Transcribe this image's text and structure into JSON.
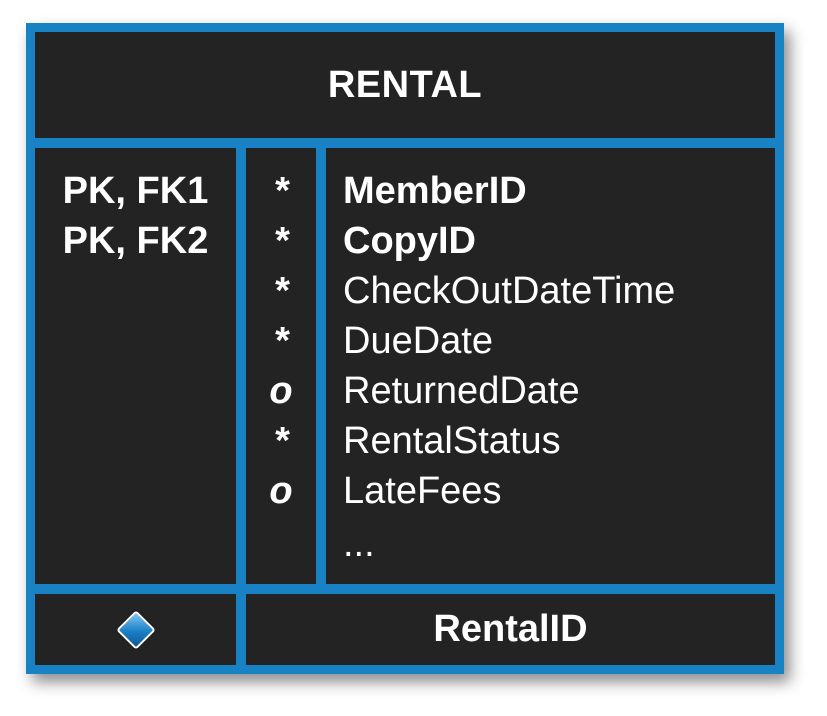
{
  "entity": {
    "name": "RENTAL",
    "key_labels": [
      "PK, FK1",
      "PK, FK2"
    ],
    "attributes": [
      {
        "optionality": "*",
        "name": "MemberID",
        "bold": true
      },
      {
        "optionality": "*",
        "name": "CopyID",
        "bold": true
      },
      {
        "optionality": "*",
        "name": "CheckOutDateTime",
        "bold": false
      },
      {
        "optionality": "*",
        "name": "DueDate",
        "bold": false
      },
      {
        "optionality": "o",
        "name": "ReturnedDate",
        "bold": false
      },
      {
        "optionality": "*",
        "name": "RentalStatus",
        "bold": false
      },
      {
        "optionality": "o",
        "name": "LateFees",
        "bold": false
      }
    ],
    "more_indicator": "...",
    "footer": {
      "icon": "diamond-icon",
      "label": "RentalID"
    }
  },
  "colors": {
    "border": "#1882c4",
    "cell_background": "#232323",
    "text": "#ffffff"
  }
}
